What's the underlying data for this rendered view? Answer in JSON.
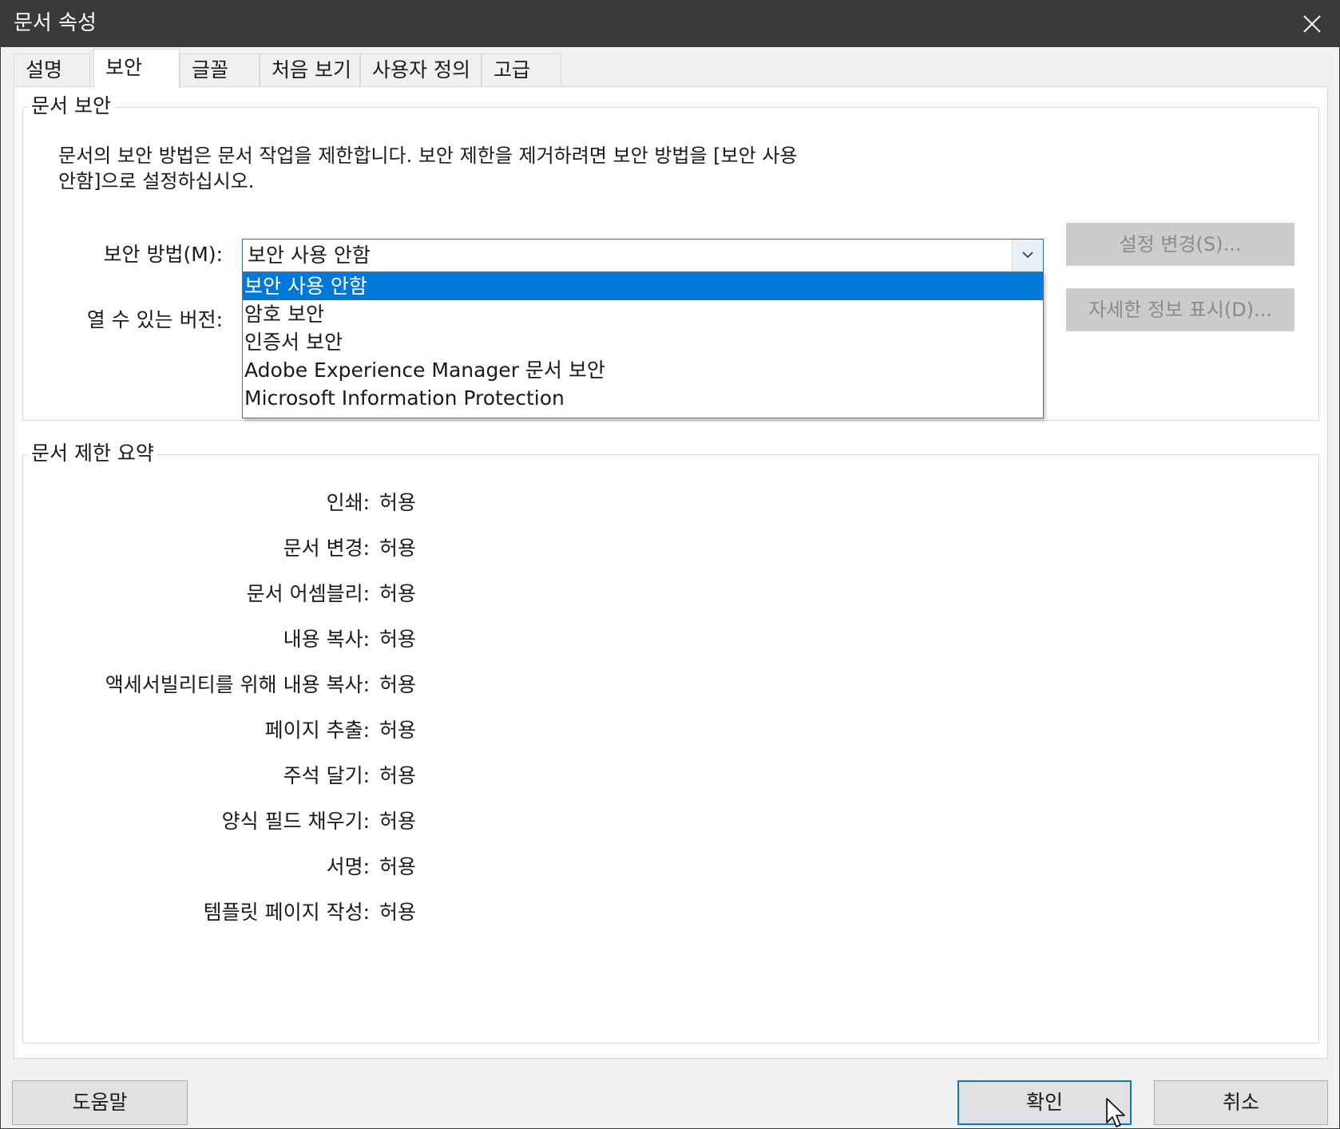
{
  "window": {
    "title": "문서 속성",
    "close_icon": "close-icon"
  },
  "tabs": [
    {
      "label": "설명",
      "active": false
    },
    {
      "label": "보안",
      "active": true
    },
    {
      "label": "글꼴",
      "active": false
    },
    {
      "label": "처음 보기",
      "active": false
    },
    {
      "label": "사용자 정의",
      "active": false
    },
    {
      "label": "고급",
      "active": false
    }
  ],
  "security": {
    "group_title": "문서 보안",
    "description": "문서의 보안 방법은 문서 작업을 제한합니다. 보안 제한을 제거하려면 보안 방법을 [보안 사용\n안함]으로 설정하십시오.",
    "method_label": "보안 방법(M):",
    "method_value": "보안 사용 안함",
    "method_options": [
      "보안 사용 안함",
      "암호 보안",
      "인증서 보안",
      "Adobe Experience Manager 문서 보안",
      "Microsoft Information Protection"
    ],
    "selected_option_index": 0,
    "openable_version_label": "열 수 있는 버전:",
    "change_settings_button": "설정 변경(S)...",
    "show_details_button": "자세한 정보 표시(D)..."
  },
  "summary": {
    "group_title": "문서 제한 요약",
    "rows": [
      {
        "label": "인쇄:",
        "value": "허용"
      },
      {
        "label": "문서 변경:",
        "value": "허용"
      },
      {
        "label": "문서 어셈블리:",
        "value": "허용"
      },
      {
        "label": "내용 복사:",
        "value": "허용"
      },
      {
        "label": "액세서빌리티를 위해 내용 복사:",
        "value": "허용"
      },
      {
        "label": "페이지 추출:",
        "value": "허용"
      },
      {
        "label": "주석 달기:",
        "value": "허용"
      },
      {
        "label": "양식 필드 채우기:",
        "value": "허용"
      },
      {
        "label": "서명:",
        "value": "허용"
      },
      {
        "label": "템플릿 페이지 작성:",
        "value": "허용"
      }
    ]
  },
  "footer": {
    "help_button": "도움말",
    "ok_button": "확인",
    "cancel_button": "취소"
  },
  "colors": {
    "titlebar": "#3a3a3a",
    "accent": "#0078d7",
    "disabled_button": "#cccccc"
  }
}
